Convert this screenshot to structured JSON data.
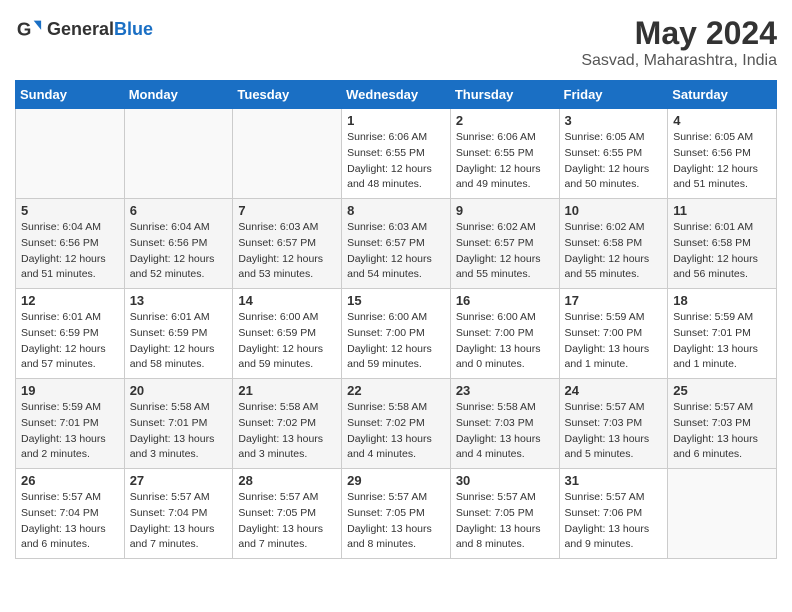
{
  "header": {
    "logo_general": "General",
    "logo_blue": "Blue",
    "month_year": "May 2024",
    "location": "Sasvad, Maharashtra, India"
  },
  "weekdays": [
    "Sunday",
    "Monday",
    "Tuesday",
    "Wednesday",
    "Thursday",
    "Friday",
    "Saturday"
  ],
  "weeks": [
    [
      {
        "day": "",
        "info": ""
      },
      {
        "day": "",
        "info": ""
      },
      {
        "day": "",
        "info": ""
      },
      {
        "day": "1",
        "info": "Sunrise: 6:06 AM\nSunset: 6:55 PM\nDaylight: 12 hours\nand 48 minutes."
      },
      {
        "day": "2",
        "info": "Sunrise: 6:06 AM\nSunset: 6:55 PM\nDaylight: 12 hours\nand 49 minutes."
      },
      {
        "day": "3",
        "info": "Sunrise: 6:05 AM\nSunset: 6:55 PM\nDaylight: 12 hours\nand 50 minutes."
      },
      {
        "day": "4",
        "info": "Sunrise: 6:05 AM\nSunset: 6:56 PM\nDaylight: 12 hours\nand 51 minutes."
      }
    ],
    [
      {
        "day": "5",
        "info": "Sunrise: 6:04 AM\nSunset: 6:56 PM\nDaylight: 12 hours\nand 51 minutes."
      },
      {
        "day": "6",
        "info": "Sunrise: 6:04 AM\nSunset: 6:56 PM\nDaylight: 12 hours\nand 52 minutes."
      },
      {
        "day": "7",
        "info": "Sunrise: 6:03 AM\nSunset: 6:57 PM\nDaylight: 12 hours\nand 53 minutes."
      },
      {
        "day": "8",
        "info": "Sunrise: 6:03 AM\nSunset: 6:57 PM\nDaylight: 12 hours\nand 54 minutes."
      },
      {
        "day": "9",
        "info": "Sunrise: 6:02 AM\nSunset: 6:57 PM\nDaylight: 12 hours\nand 55 minutes."
      },
      {
        "day": "10",
        "info": "Sunrise: 6:02 AM\nSunset: 6:58 PM\nDaylight: 12 hours\nand 55 minutes."
      },
      {
        "day": "11",
        "info": "Sunrise: 6:01 AM\nSunset: 6:58 PM\nDaylight: 12 hours\nand 56 minutes."
      }
    ],
    [
      {
        "day": "12",
        "info": "Sunrise: 6:01 AM\nSunset: 6:59 PM\nDaylight: 12 hours\nand 57 minutes."
      },
      {
        "day": "13",
        "info": "Sunrise: 6:01 AM\nSunset: 6:59 PM\nDaylight: 12 hours\nand 58 minutes."
      },
      {
        "day": "14",
        "info": "Sunrise: 6:00 AM\nSunset: 6:59 PM\nDaylight: 12 hours\nand 59 minutes."
      },
      {
        "day": "15",
        "info": "Sunrise: 6:00 AM\nSunset: 7:00 PM\nDaylight: 12 hours\nand 59 minutes."
      },
      {
        "day": "16",
        "info": "Sunrise: 6:00 AM\nSunset: 7:00 PM\nDaylight: 13 hours\nand 0 minutes."
      },
      {
        "day": "17",
        "info": "Sunrise: 5:59 AM\nSunset: 7:00 PM\nDaylight: 13 hours\nand 1 minute."
      },
      {
        "day": "18",
        "info": "Sunrise: 5:59 AM\nSunset: 7:01 PM\nDaylight: 13 hours\nand 1 minute."
      }
    ],
    [
      {
        "day": "19",
        "info": "Sunrise: 5:59 AM\nSunset: 7:01 PM\nDaylight: 13 hours\nand 2 minutes."
      },
      {
        "day": "20",
        "info": "Sunrise: 5:58 AM\nSunset: 7:01 PM\nDaylight: 13 hours\nand 3 minutes."
      },
      {
        "day": "21",
        "info": "Sunrise: 5:58 AM\nSunset: 7:02 PM\nDaylight: 13 hours\nand 3 minutes."
      },
      {
        "day": "22",
        "info": "Sunrise: 5:58 AM\nSunset: 7:02 PM\nDaylight: 13 hours\nand 4 minutes."
      },
      {
        "day": "23",
        "info": "Sunrise: 5:58 AM\nSunset: 7:03 PM\nDaylight: 13 hours\nand 4 minutes."
      },
      {
        "day": "24",
        "info": "Sunrise: 5:57 AM\nSunset: 7:03 PM\nDaylight: 13 hours\nand 5 minutes."
      },
      {
        "day": "25",
        "info": "Sunrise: 5:57 AM\nSunset: 7:03 PM\nDaylight: 13 hours\nand 6 minutes."
      }
    ],
    [
      {
        "day": "26",
        "info": "Sunrise: 5:57 AM\nSunset: 7:04 PM\nDaylight: 13 hours\nand 6 minutes."
      },
      {
        "day": "27",
        "info": "Sunrise: 5:57 AM\nSunset: 7:04 PM\nDaylight: 13 hours\nand 7 minutes."
      },
      {
        "day": "28",
        "info": "Sunrise: 5:57 AM\nSunset: 7:05 PM\nDaylight: 13 hours\nand 7 minutes."
      },
      {
        "day": "29",
        "info": "Sunrise: 5:57 AM\nSunset: 7:05 PM\nDaylight: 13 hours\nand 8 minutes."
      },
      {
        "day": "30",
        "info": "Sunrise: 5:57 AM\nSunset: 7:05 PM\nDaylight: 13 hours\nand 8 minutes."
      },
      {
        "day": "31",
        "info": "Sunrise: 5:57 AM\nSunset: 7:06 PM\nDaylight: 13 hours\nand 9 minutes."
      },
      {
        "day": "",
        "info": ""
      }
    ]
  ]
}
